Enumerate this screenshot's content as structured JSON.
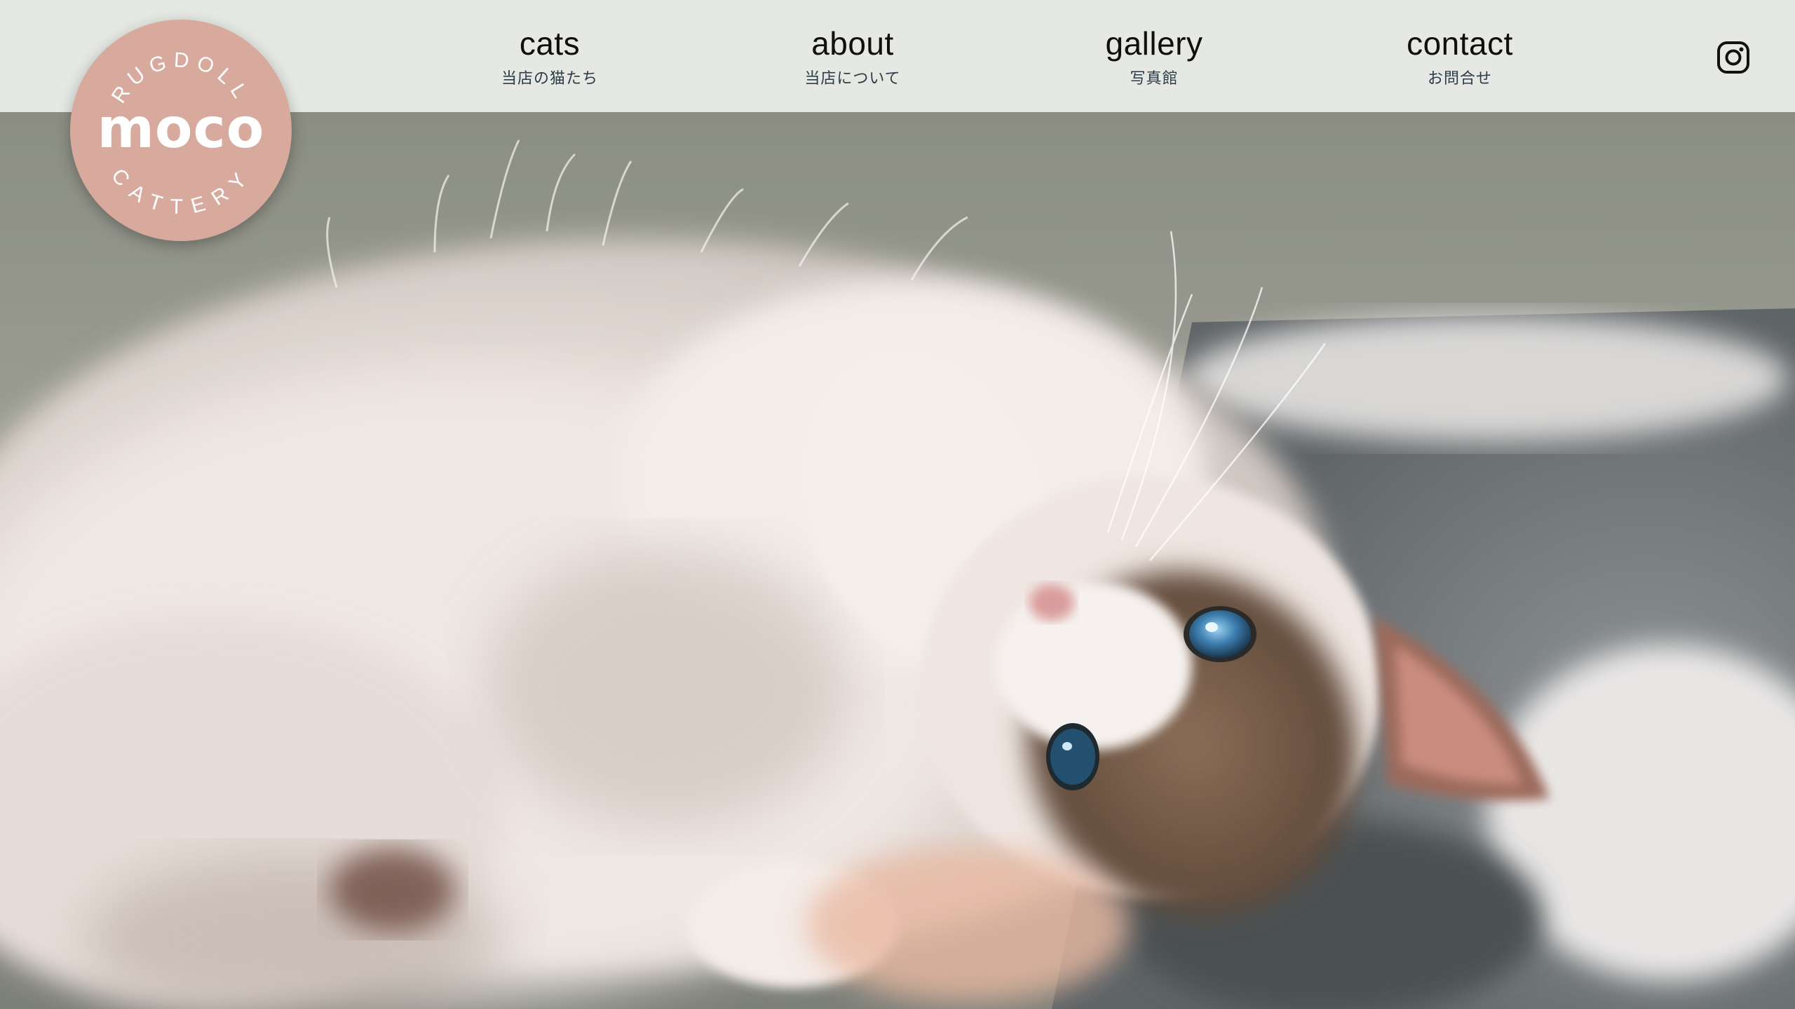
{
  "site": {
    "logo": {
      "top_text": "RUGDOLL",
      "main_text": "moco",
      "bottom_text": "CATTERY"
    }
  },
  "nav": {
    "items": [
      {
        "en": "cats",
        "ja": "当店の猫たち"
      },
      {
        "en": "about",
        "ja": "当店について"
      },
      {
        "en": "gallery",
        "ja": "写真館"
      },
      {
        "en": "contact",
        "ja": "お問合せ"
      }
    ],
    "social_icon": "instagram-icon"
  },
  "hero": {
    "image": "ragdoll-kitten-lying-on-rug-photo"
  },
  "colors": {
    "header_bg": "#e6e8e4",
    "logo_pink": "#d8a99d",
    "nav_text": "#0f0f0f",
    "nav_subtext": "#2c3b46"
  }
}
